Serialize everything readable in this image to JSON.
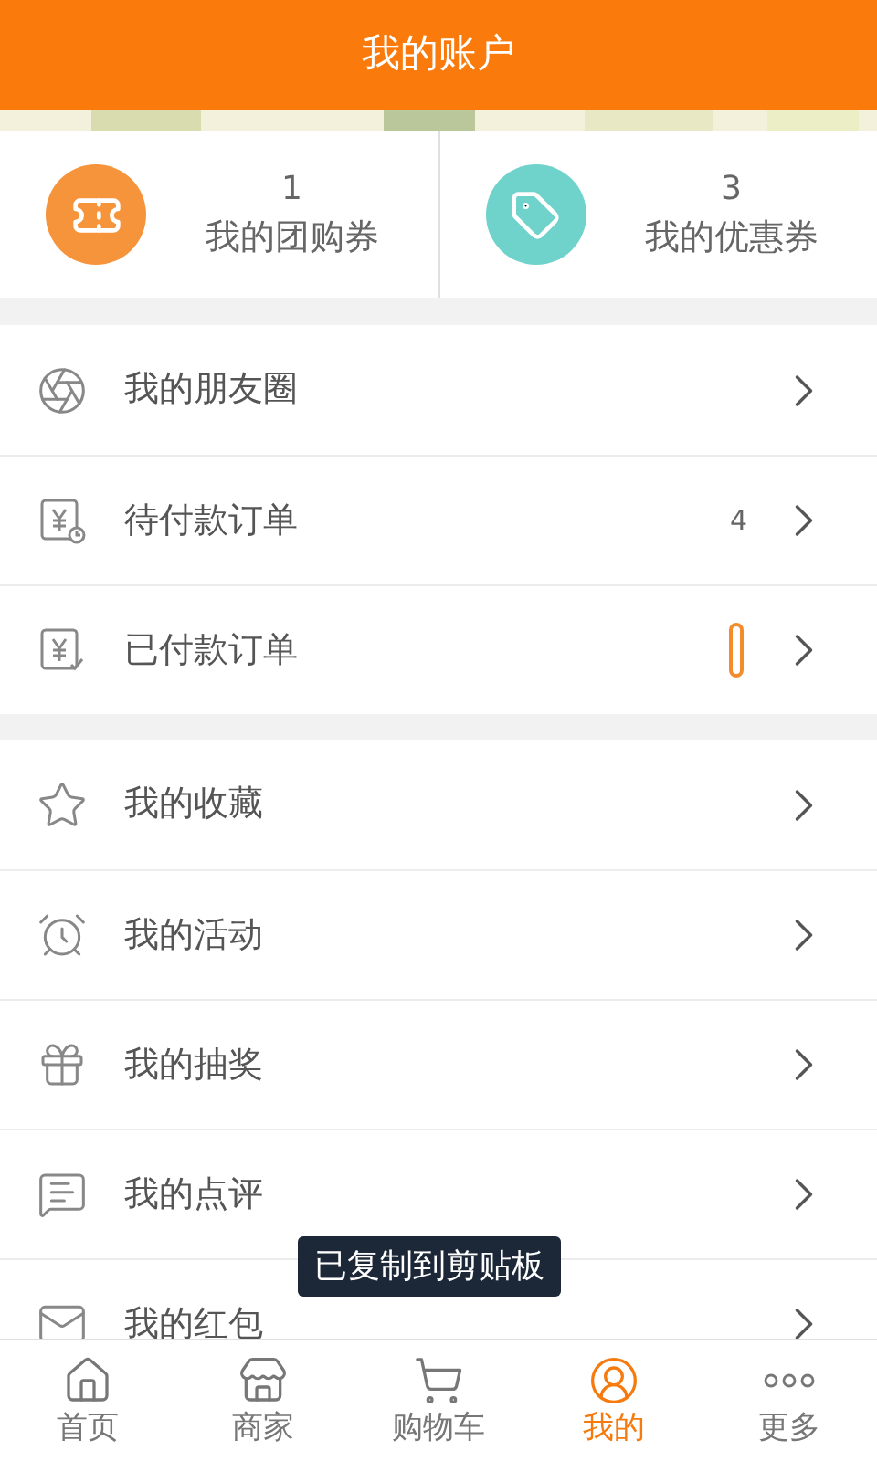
{
  "header": {
    "title": "我的账户"
  },
  "cards": [
    {
      "count": "1",
      "label": "我的团购券",
      "color": "#f6943c"
    },
    {
      "count": "3",
      "label": "我的优惠券",
      "color": "#6fd3cb"
    }
  ],
  "groups": [
    [
      {
        "label": "我的朋友圈"
      },
      {
        "label": "待付款订单",
        "count": "4"
      },
      {
        "label": "已付款订单",
        "badge": true
      }
    ],
    [
      {
        "label": "我的收藏"
      },
      {
        "label": "我的活动"
      },
      {
        "label": "我的抽奖"
      },
      {
        "label": "我的点评"
      },
      {
        "label": "我的红包"
      }
    ]
  ],
  "toast": "已复制到剪贴板",
  "tabs": [
    {
      "label": "首页",
      "selected": false
    },
    {
      "label": "商家",
      "selected": false
    },
    {
      "label": "购物车",
      "selected": false
    },
    {
      "label": "我的",
      "selected": true
    },
    {
      "label": "更多",
      "selected": false
    }
  ]
}
